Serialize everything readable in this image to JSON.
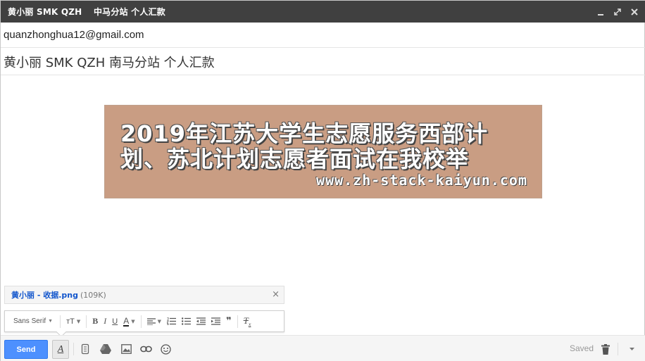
{
  "window": {
    "title": "黄小丽 SMK QZH　 中马分站 个人汇款",
    "minimize": "–",
    "popout": "⤢",
    "close": "×"
  },
  "compose": {
    "to": "quanzhonghua12@gmail.com",
    "subject": "黄小丽  SMK QZH  南马分站  个人汇款"
  },
  "body_image": {
    "line1": "2019年江苏大学生志愿服务西部计",
    "line2": "划、苏北计划志愿者面试在我校举",
    "watermark": "www.zh-stack-kaiyun.com"
  },
  "attachment": {
    "name": "黄小丽 - 收据.png",
    "size": "(109K)",
    "close": "×"
  },
  "formatting": {
    "font": "Sans Serif",
    "size_icon": "тT",
    "bold": "B",
    "italic": "I",
    "underline": "U",
    "text_color": "A",
    "quote": "❞",
    "remove_format": "T",
    "remove_format_sub": "x"
  },
  "actions": {
    "send_label": "Send",
    "format_toggle": "A",
    "saved_label": "Saved"
  },
  "colors": {
    "send": "#4d90fe",
    "titlebar": "#404040",
    "banner": "#c99d83",
    "link": "#1155cc"
  }
}
